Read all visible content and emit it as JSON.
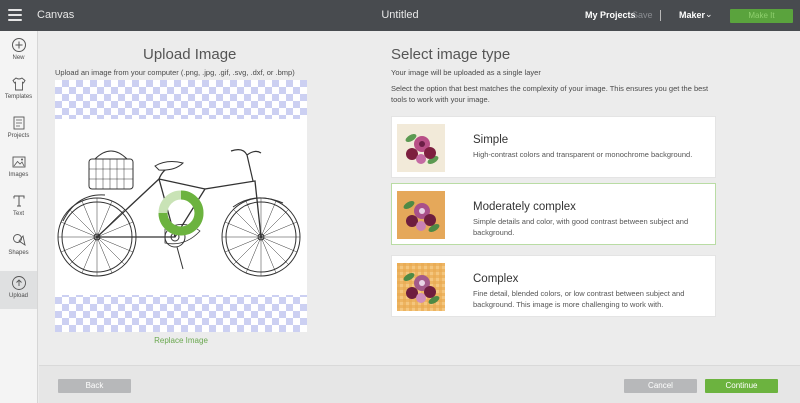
{
  "topbar": {
    "app_title": "Canvas",
    "doc_title": "Untitled",
    "my_projects": "My Projects",
    "save": "Save",
    "machine": "Maker",
    "make_it": "Make It"
  },
  "sidebar": {
    "items": [
      {
        "label": "New",
        "icon": "plus-circle-icon"
      },
      {
        "label": "Templates",
        "icon": "shirt-icon"
      },
      {
        "label": "Projects",
        "icon": "projects-icon"
      },
      {
        "label": "Images",
        "icon": "image-icon"
      },
      {
        "label": "Text",
        "icon": "text-icon"
      },
      {
        "label": "Shapes",
        "icon": "shapes-icon"
      },
      {
        "label": "Upload",
        "icon": "upload-icon",
        "active": true
      }
    ]
  },
  "upload": {
    "title": "Upload Image",
    "subtitle": "Upload an image from your computer (.png, .jpg, .gif, .svg, .dxf, or .bmp)",
    "replace_link": "Replace Image"
  },
  "image_type": {
    "title": "Select image type",
    "subtitle": "Your image will be uploaded as a single layer",
    "instructions": "Select the option that best matches the complexity of your image. This ensures you get the best tools to work with your image.",
    "options": [
      {
        "title": "Simple",
        "description": "High-contrast colors and transparent or monochrome background.",
        "selected": false
      },
      {
        "title": "Moderately complex",
        "description": "Simple details and color, with good contrast between subject and background.",
        "selected": true
      },
      {
        "title": "Complex",
        "description": "Fine detail, blended colors, or low contrast between subject and background. This image is more challenging to work with.",
        "selected": false
      }
    ]
  },
  "footer": {
    "back": "Back",
    "cancel": "Cancel",
    "continue": "Continue"
  },
  "colors": {
    "accent_green": "#6cb33f",
    "topbar": "#484b4f"
  }
}
